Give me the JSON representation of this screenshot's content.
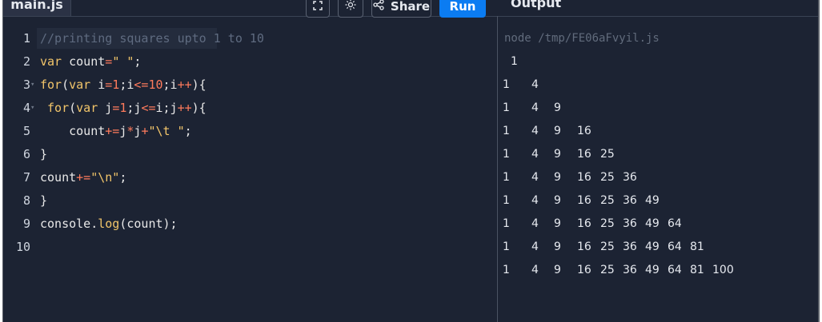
{
  "tab": {
    "filename": "main.js"
  },
  "toolbar": {
    "fullscreen_icon": "fullscreen-icon",
    "theme_icon": "sun-icon",
    "share_label": "Share",
    "run_label": "Run"
  },
  "output": {
    "label": "Output",
    "command": "node /tmp/FE06aFvyil.js",
    "rows": [
      [
        "1"
      ],
      [
        "1",
        "4"
      ],
      [
        "1",
        "4",
        "9"
      ],
      [
        "1",
        "4",
        "9",
        "16"
      ],
      [
        "1",
        "4",
        "9",
        "16",
        "25"
      ],
      [
        "1",
        "4",
        "9",
        "16",
        "25",
        "36"
      ],
      [
        "1",
        "4",
        "9",
        "16",
        "25",
        "36",
        "49"
      ],
      [
        "1",
        "4",
        "9",
        "16",
        "25",
        "36",
        "49",
        "64"
      ],
      [
        "1",
        "4",
        "9",
        "16",
        "25",
        "36",
        "49",
        "64",
        "81"
      ],
      [
        "1",
        "4",
        "9",
        "16",
        "25",
        "36",
        "49",
        "64",
        "81",
        "100"
      ]
    ]
  },
  "editor": {
    "line_numbers": [
      "1",
      "2",
      "3",
      "4",
      "5",
      "6",
      "7",
      "8",
      "9",
      "10"
    ],
    "lines": [
      "//printing squares upto 1 to 10",
      "var count=\" \";",
      "for(var i=1;i<=10;i++){",
      " for(var j=1;j<=i;j++){",
      "    count+=j*j+\"\\t \";",
      "}",
      "count+=\"\\n\";",
      "}",
      "console.log(count);",
      ""
    ]
  },
  "colors": {
    "background": "#1c2333",
    "keyword": "#f2c56a",
    "number": "#ff7b5c",
    "comment": "#5f6b80",
    "run_button": "#0b7cf2"
  }
}
